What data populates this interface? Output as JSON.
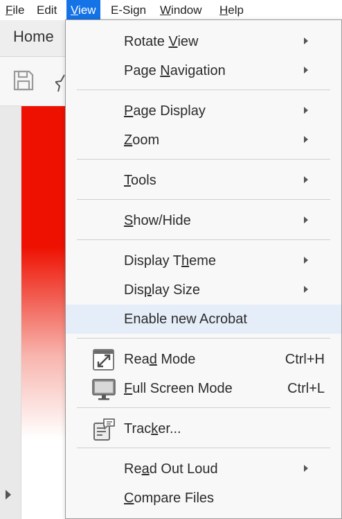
{
  "menubar": {
    "items": [
      {
        "label": "File",
        "u": "F",
        "rest": "ile",
        "active": false
      },
      {
        "label": "Edit",
        "u": "",
        "rest": "Edit",
        "active": false
      },
      {
        "label": "View",
        "u": "V",
        "rest": "iew",
        "active": true
      },
      {
        "label": "E-Sign",
        "u": "",
        "rest": "E-Sign",
        "active": false
      },
      {
        "label": "Window",
        "u": "W",
        "rest": "indow",
        "active": false
      },
      {
        "label": "Help",
        "u": "H",
        "rest": "elp",
        "active": false
      }
    ]
  },
  "tabs": {
    "home": "Home"
  },
  "toolbar": {
    "save_icon": "save-icon",
    "star_icon": "star-icon"
  },
  "view_menu": {
    "items": [
      {
        "name": "menu-item-rotate-view",
        "pre": "Rotate ",
        "u": "V",
        "post": "iew",
        "submenu": true
      },
      {
        "name": "menu-item-page-navigation",
        "pre": "Page ",
        "u": "N",
        "post": "avigation",
        "submenu": true
      },
      {
        "name": "menu-item-page-display",
        "pre": "",
        "u": "P",
        "post": "age Display",
        "submenu": true
      },
      {
        "name": "menu-item-zoom",
        "pre": "",
        "u": "Z",
        "post": "oom",
        "submenu": true
      },
      {
        "name": "menu-item-tools",
        "pre": "",
        "u": "T",
        "post": "ools",
        "submenu": true
      },
      {
        "name": "menu-item-show-hide",
        "pre": "",
        "u": "S",
        "post": "how/Hide",
        "submenu": true
      },
      {
        "name": "menu-item-display-theme",
        "pre": "Display T",
        "u": "h",
        "post": "eme",
        "submenu": true
      },
      {
        "name": "menu-item-display-size",
        "pre": "Dis",
        "u": "p",
        "post": "lay Size",
        "submenu": true
      },
      {
        "name": "menu-item-enable-new-acrobat",
        "pre": "Enable new Acrobat",
        "u": "",
        "post": "",
        "submenu": false,
        "highlighted": true
      },
      {
        "name": "menu-item-read-mode",
        "pre": "Rea",
        "u": "d",
        "post": " Mode",
        "submenu": false,
        "shortcut": "Ctrl+H",
        "icon": "read-mode-icon"
      },
      {
        "name": "menu-item-full-screen-mode",
        "pre": "",
        "u": "F",
        "post": "ull Screen Mode",
        "submenu": false,
        "shortcut": "Ctrl+L",
        "icon": "full-screen-icon"
      },
      {
        "name": "menu-item-tracker",
        "pre": "Trac",
        "u": "k",
        "post": "er...",
        "submenu": false,
        "icon": "tracker-icon"
      },
      {
        "name": "menu-item-read-out-loud",
        "pre": "Re",
        "u": "a",
        "post": "d Out Loud",
        "submenu": true
      },
      {
        "name": "menu-item-compare-files",
        "pre": "",
        "u": "C",
        "post": "ompare Files",
        "submenu": false
      }
    ]
  },
  "colors": {
    "accent": "#1473e6",
    "highlight": "#e5eef8",
    "red": "#ee1000"
  }
}
